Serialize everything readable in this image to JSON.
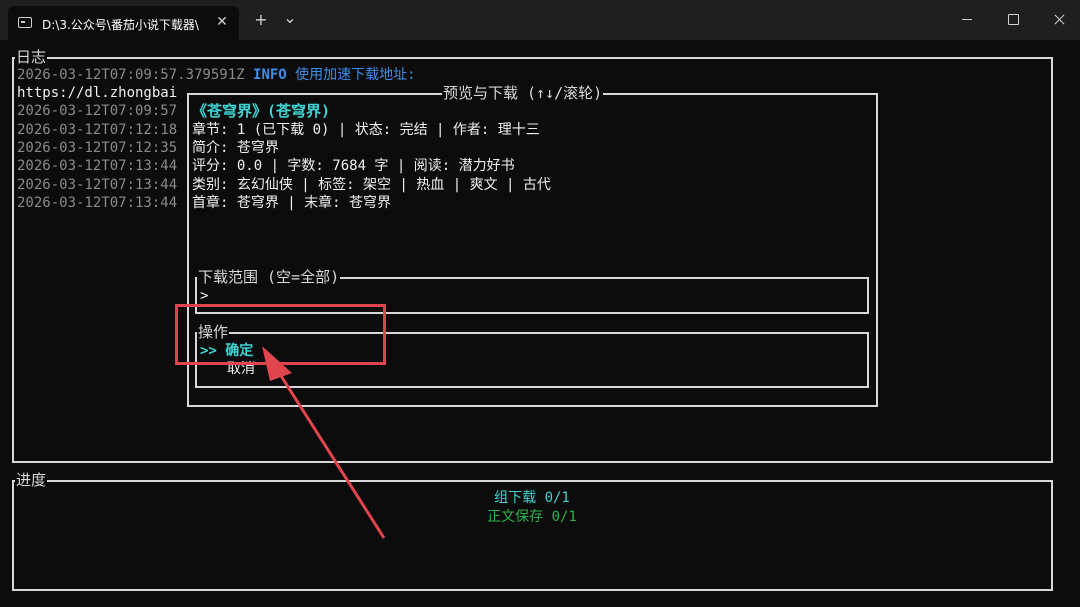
{
  "window": {
    "tab_title": "D:\\3.公众号\\番茄小说下载器\\",
    "close_tab": "✕",
    "new_tab": "+",
    "dropdown": "⌄"
  },
  "log": {
    "title": "日志",
    "entries": [
      {
        "ts": "2026-03-12T07:09:57.379591Z",
        "level": "INFO",
        "msg": "使用加速下载地址:"
      },
      {
        "ts": "https://dl.zhongbai"
      },
      {
        "ts": "2026-03-12T07:09:57"
      },
      {
        "ts": "2026-03-12T07:12:18"
      },
      {
        "ts": "2026-03-12T07:12:35"
      },
      {
        "ts": "2026-03-12T07:13:44"
      },
      {
        "ts": "2026-03-12T07:13:44"
      },
      {
        "ts": "2026-03-12T07:13:44"
      }
    ]
  },
  "preview": {
    "title": "预览与下载 (↑↓/滚轮)",
    "book_title": "《苍穹界》(苍穹界)",
    "lines": [
      "章节: 1 (已下载 0) | 状态: 完结 | 作者: 理十三",
      "简介: 苍穹界",
      "评分: 0.0 | 字数: 7684 字 | 阅读: 潜力好书",
      "类别: 玄幻仙侠 | 标签: 架空 | 热血 | 爽文 | 古代",
      "首章: 苍穹界 | 末章: 苍穹界"
    ],
    "range": {
      "title": "下载范围 (空=全部)",
      "prompt": ">"
    },
    "actions": {
      "title": "操作",
      "confirm": ">> 确定",
      "cancel": "取消"
    }
  },
  "progress": {
    "title": "进度",
    "group_download": "组下载 0/1",
    "text_save": "正文保存 0/1"
  },
  "colors": {
    "info": "#3b8eea",
    "highlight": "#3fd3d3",
    "success": "#2fb24a",
    "annotation": "#e0454e"
  }
}
